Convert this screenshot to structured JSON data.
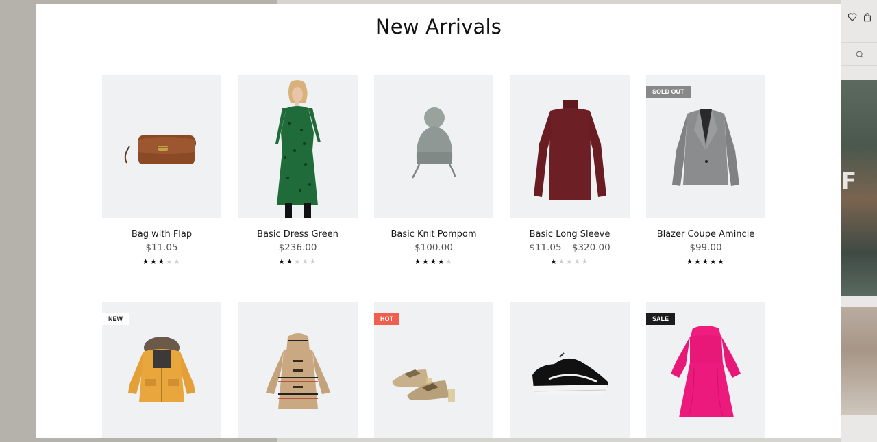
{
  "modal": {
    "title": "New Arrivals"
  },
  "backdrop": {
    "hero_letter": "F",
    "icons": [
      "heart-icon",
      "bag-icon",
      "search-icon"
    ]
  },
  "products": [
    {
      "name": "Bag with Flap",
      "price": "$11.05",
      "rating": 3,
      "badge": "",
      "image": "brown-leather-bag"
    },
    {
      "name": "Basic Dress Green",
      "price": "$236.00",
      "rating": 2,
      "badge": "",
      "image": "green-print-dress-model"
    },
    {
      "name": "Basic Knit Pompom",
      "price": "$100.00",
      "rating": 4,
      "badge": "",
      "image": "grey-knit-beanie"
    },
    {
      "name": "Basic Long Sleeve",
      "price": "$11.05 – $320.00",
      "rating": 1,
      "badge": "",
      "image": "burgundy-turtleneck"
    },
    {
      "name": "Blazer Coupe Amincie",
      "price": "$99.00",
      "rating": 5,
      "badge": "SOLD OUT",
      "image": "grey-blazer"
    },
    {
      "name": "",
      "price": "",
      "rating": 0,
      "badge": "NEW",
      "image": "yellow-parka"
    },
    {
      "name": "",
      "price": "",
      "rating": 0,
      "badge": "",
      "image": "striped-duffle-coat"
    },
    {
      "name": "",
      "price": "",
      "rating": 0,
      "badge": "HOT",
      "image": "snakeskin-mules"
    },
    {
      "name": "",
      "price": "",
      "rating": 0,
      "badge": "",
      "image": "black-sneaker"
    },
    {
      "name": "",
      "price": "",
      "rating": 0,
      "badge": "SALE",
      "image": "pink-dress"
    }
  ],
  "colors": {
    "thumb_bg": "#f0f1f3",
    "badge_hot": "#f05e4d",
    "badge_sale": "#1c1c1c",
    "badge_sold_out": "#888888"
  }
}
